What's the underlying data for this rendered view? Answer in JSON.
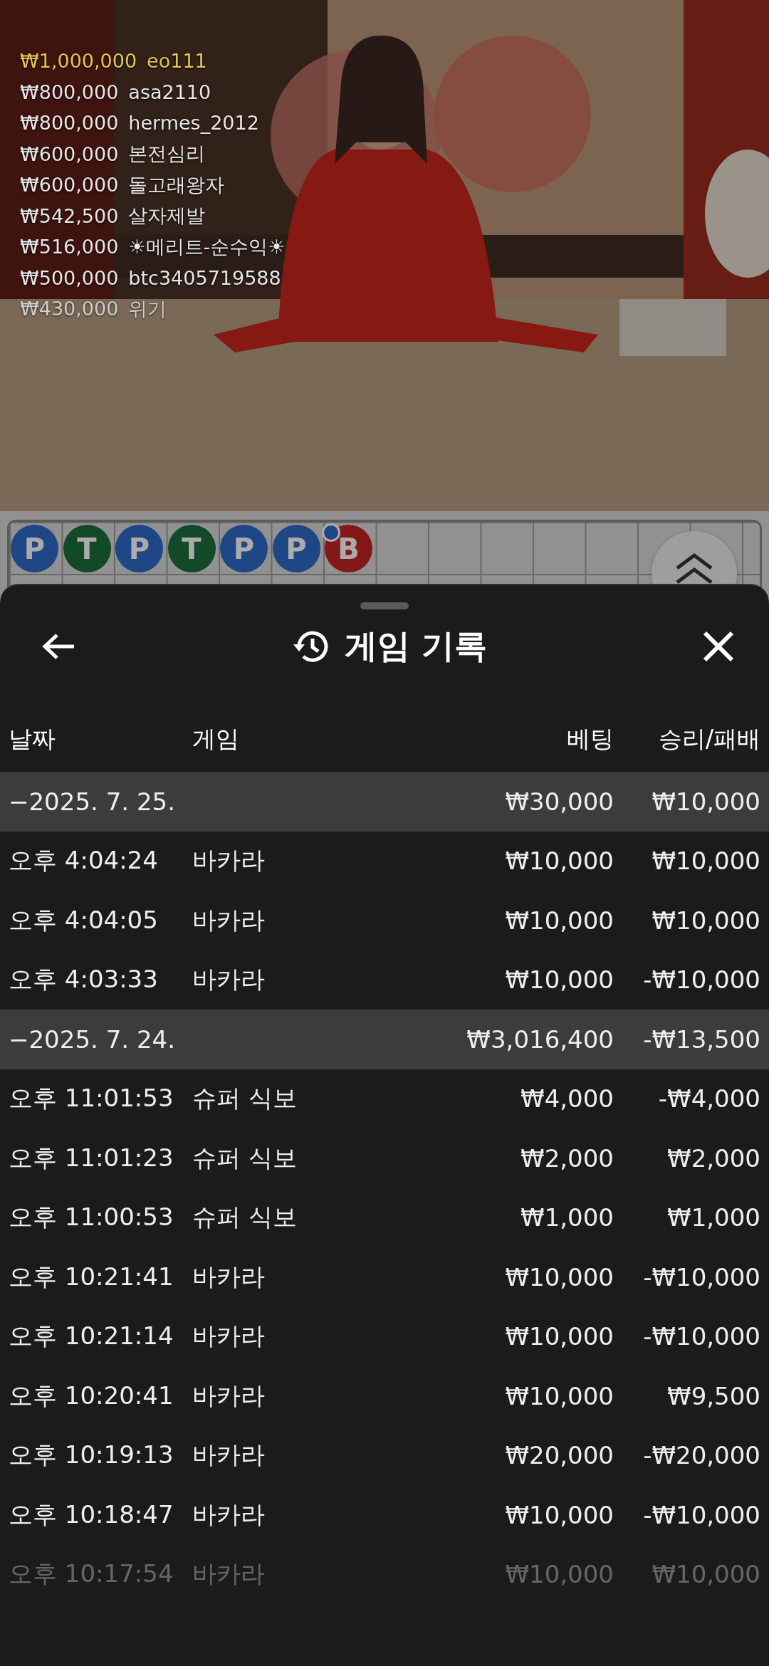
{
  "leaderboard": [
    {
      "amount": "₩1,000,000",
      "name": "eo111",
      "highlighted": true,
      "faded": false
    },
    {
      "amount": "₩800,000",
      "name": "asa2110",
      "highlighted": false,
      "faded": false
    },
    {
      "amount": "₩800,000",
      "name": "hermes_2012",
      "highlighted": false,
      "faded": false
    },
    {
      "amount": "₩600,000",
      "name": "본전심리",
      "highlighted": false,
      "faded": false
    },
    {
      "amount": "₩600,000",
      "name": "돌고래왕자",
      "highlighted": false,
      "faded": false
    },
    {
      "amount": "₩542,500",
      "name": "살자제발",
      "highlighted": false,
      "faded": false
    },
    {
      "amount": "₩516,000",
      "name": "☀메리트-순수익☀",
      "highlighted": false,
      "faded": false
    },
    {
      "amount": "₩500,000",
      "name": "btc3405719588",
      "highlighted": false,
      "faded": false
    },
    {
      "amount": "₩430,000",
      "name": "위기",
      "highlighted": false,
      "faded": true
    }
  ],
  "bead_road": [
    {
      "result": "P",
      "kind": "player",
      "pair_dot": false
    },
    {
      "result": "T",
      "kind": "tie",
      "pair_dot": false
    },
    {
      "result": "P",
      "kind": "player",
      "pair_dot": false
    },
    {
      "result": "T",
      "kind": "tie",
      "pair_dot": false
    },
    {
      "result": "P",
      "kind": "player",
      "pair_dot": false
    },
    {
      "result": "P",
      "kind": "player",
      "pair_dot": false
    },
    {
      "result": "B",
      "kind": "banker",
      "pair_dot": true
    }
  ],
  "sheet": {
    "title": "게임 기록",
    "columns": [
      "날짜",
      "게임",
      "베팅",
      "승리/패배"
    ],
    "rows": [
      {
        "kind": "group",
        "date": "−2025. 7. 25.",
        "bet": "₩30,000",
        "result": "₩10,000",
        "faded": false
      },
      {
        "kind": "entry",
        "date": "오후 4:04:24",
        "game": "바카라",
        "bet": "₩10,000",
        "result": "₩10,000",
        "faded": false
      },
      {
        "kind": "entry",
        "date": "오후 4:04:05",
        "game": "바카라",
        "bet": "₩10,000",
        "result": "₩10,000",
        "faded": false
      },
      {
        "kind": "entry",
        "date": "오후 4:03:33",
        "game": "바카라",
        "bet": "₩10,000",
        "result": "-₩10,000",
        "faded": false
      },
      {
        "kind": "group",
        "date": "−2025. 7. 24.",
        "bet": "₩3,016,400",
        "result": "-₩13,500",
        "faded": false
      },
      {
        "kind": "entry",
        "date": "오후 11:01:53",
        "game": "슈퍼 식보",
        "bet": "₩4,000",
        "result": "-₩4,000",
        "faded": false
      },
      {
        "kind": "entry",
        "date": "오후 11:01:23",
        "game": "슈퍼 식보",
        "bet": "₩2,000",
        "result": "₩2,000",
        "faded": false
      },
      {
        "kind": "entry",
        "date": "오후 11:00:53",
        "game": "슈퍼 식보",
        "bet": "₩1,000",
        "result": "₩1,000",
        "faded": false
      },
      {
        "kind": "entry",
        "date": "오후 10:21:41",
        "game": "바카라",
        "bet": "₩10,000",
        "result": "-₩10,000",
        "faded": false
      },
      {
        "kind": "entry",
        "date": "오후 10:21:14",
        "game": "바카라",
        "bet": "₩10,000",
        "result": "-₩10,000",
        "faded": false
      },
      {
        "kind": "entry",
        "date": "오후 10:20:41",
        "game": "바카라",
        "bet": "₩10,000",
        "result": "₩9,500",
        "faded": false
      },
      {
        "kind": "entry",
        "date": "오후 10:19:13",
        "game": "바카라",
        "bet": "₩20,000",
        "result": "-₩20,000",
        "faded": false
      },
      {
        "kind": "entry",
        "date": "오후 10:18:47",
        "game": "바카라",
        "bet": "₩10,000",
        "result": "-₩10,000",
        "faded": false
      },
      {
        "kind": "entry",
        "date": "오후 10:17:54",
        "game": "바카라",
        "bet": "₩10,000",
        "result": "₩10,000",
        "faded": true
      }
    ]
  }
}
